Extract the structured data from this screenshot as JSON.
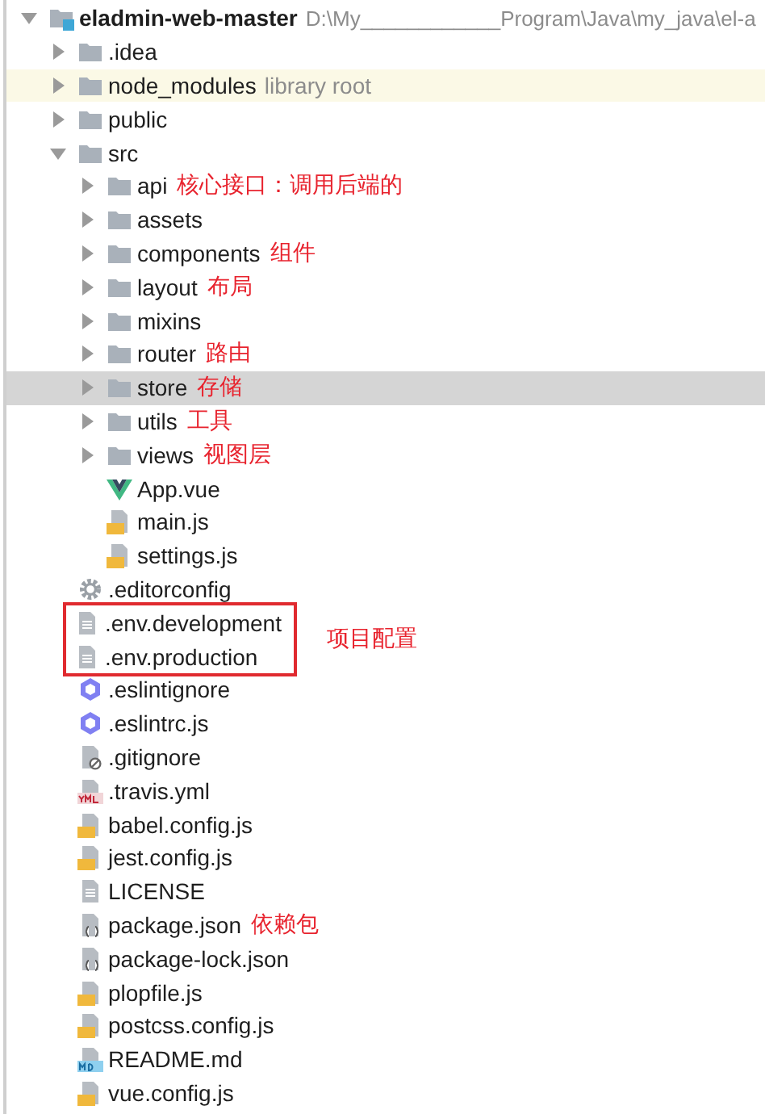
{
  "project_tree": {
    "root": {
      "name": "eladmin-web-master",
      "path": "D:\\My____________Program\\Java\\my_java\\el-a",
      "kind": "module",
      "expanded": true,
      "selected": false,
      "highlighted": false,
      "children": [
        {
          "name": ".idea",
          "kind": "folder",
          "expanded": false,
          "selected": false,
          "highlighted": false
        },
        {
          "name": "node_modules",
          "hint": "library root",
          "kind": "folder",
          "expanded": false,
          "selected": false,
          "highlighted": true
        },
        {
          "name": "public",
          "kind": "folder",
          "expanded": false,
          "selected": false,
          "highlighted": false
        },
        {
          "name": "src",
          "kind": "folder",
          "expanded": true,
          "selected": false,
          "highlighted": false,
          "children": [
            {
              "name": "api",
              "annotation": "核心接口：调用后端的",
              "kind": "folder",
              "expanded": false,
              "selected": false,
              "highlighted": false
            },
            {
              "name": "assets",
              "kind": "folder",
              "expanded": false,
              "selected": false,
              "highlighted": false
            },
            {
              "name": "components",
              "annotation": "组件",
              "kind": "folder",
              "expanded": false,
              "selected": false,
              "highlighted": false
            },
            {
              "name": "layout",
              "annotation": "布局",
              "kind": "folder",
              "expanded": false,
              "selected": false,
              "highlighted": false
            },
            {
              "name": "mixins",
              "kind": "folder",
              "expanded": false,
              "selected": false,
              "highlighted": false
            },
            {
              "name": "router",
              "annotation": "路由",
              "kind": "folder",
              "expanded": false,
              "selected": false,
              "highlighted": false
            },
            {
              "name": "store",
              "annotation": "存储",
              "kind": "folder",
              "expanded": false,
              "selected": true,
              "highlighted": false
            },
            {
              "name": "utils",
              "annotation": "工具",
              "kind": "folder",
              "expanded": false,
              "selected": false,
              "highlighted": false
            },
            {
              "name": "views",
              "annotation": "视图层",
              "kind": "folder",
              "expanded": false,
              "selected": false,
              "highlighted": false
            },
            {
              "name": "App.vue",
              "kind": "vue",
              "selected": false,
              "highlighted": false
            },
            {
              "name": "main.js",
              "kind": "js",
              "selected": false,
              "highlighted": false
            },
            {
              "name": "settings.js",
              "kind": "js",
              "selected": false,
              "highlighted": false
            }
          ]
        },
        {
          "name": ".editorconfig",
          "kind": "gear",
          "selected": false,
          "highlighted": false
        },
        {
          "name": ".env.development",
          "kind": "text",
          "boxed": true,
          "selected": false,
          "highlighted": false
        },
        {
          "name": ".env.production",
          "kind": "text",
          "boxed": true,
          "selected": false,
          "highlighted": false
        },
        {
          "name": ".eslintignore",
          "kind": "eslint",
          "selected": false,
          "highlighted": false
        },
        {
          "name": ".eslintrc.js",
          "kind": "eslint",
          "selected": false,
          "highlighted": false
        },
        {
          "name": ".gitignore",
          "kind": "ignore",
          "selected": false,
          "highlighted": false
        },
        {
          "name": ".travis.yml",
          "kind": "yml",
          "selected": false,
          "highlighted": false
        },
        {
          "name": "babel.config.js",
          "kind": "js",
          "selected": false,
          "highlighted": false
        },
        {
          "name": "jest.config.js",
          "kind": "js",
          "selected": false,
          "highlighted": false
        },
        {
          "name": "LICENSE",
          "kind": "text",
          "selected": false,
          "highlighted": false
        },
        {
          "name": "package.json",
          "annotation": "依赖包",
          "kind": "json",
          "selected": false,
          "highlighted": false
        },
        {
          "name": "package-lock.json",
          "kind": "json",
          "selected": false,
          "highlighted": false
        },
        {
          "name": "plopfile.js",
          "kind": "js",
          "selected": false,
          "highlighted": false
        },
        {
          "name": "postcss.config.js",
          "kind": "js",
          "selected": false,
          "highlighted": false
        },
        {
          "name": "README.md",
          "kind": "md",
          "selected": false,
          "highlighted": false
        },
        {
          "name": "vue.config.js",
          "kind": "js",
          "selected": false,
          "highlighted": false
        }
      ]
    }
  },
  "box_callout": "项目配置"
}
